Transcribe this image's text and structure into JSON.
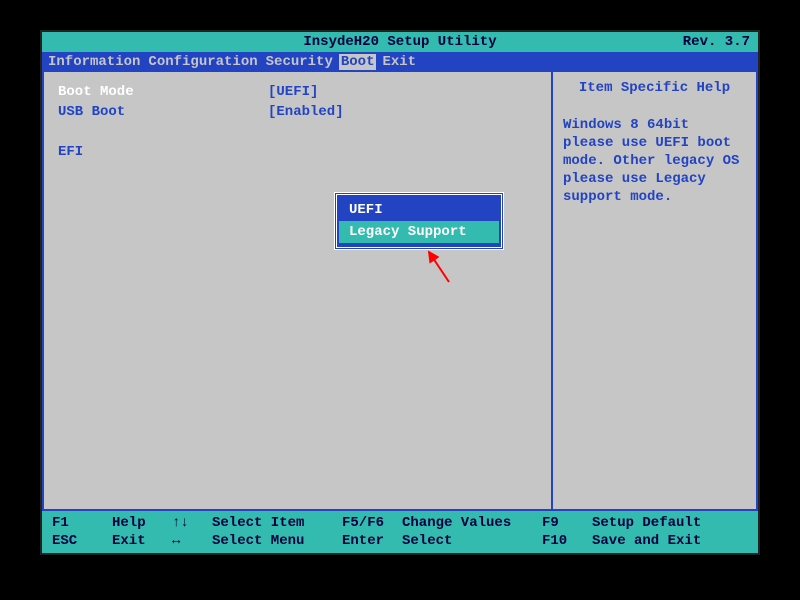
{
  "title": "InsydeH20 Setup Utility",
  "revision": "Rev. 3.7",
  "menu": {
    "items": [
      "Information",
      "Configuration",
      "Security",
      "Boot",
      "Exit"
    ],
    "active_index": 3
  },
  "settings": [
    {
      "label": "Boot Mode",
      "value": "[UEFI]",
      "selected": true
    },
    {
      "label": "USB Boot",
      "value": "[Enabled]",
      "selected": false
    },
    {
      "label": "",
      "value": "",
      "selected": false
    },
    {
      "label": "EFI",
      "value": "",
      "selected": false
    }
  ],
  "popup": {
    "options": [
      "UEFI",
      "Legacy Support"
    ],
    "highlight_index": 1
  },
  "help": {
    "title": "Item Specific Help",
    "text": "Windows 8 64bit please use UEFI boot mode. Other legacy OS please use Legacy support mode."
  },
  "footer": {
    "rows": [
      {
        "k1": "F1",
        "k2": "Help",
        "k3": "↑↓",
        "k4": "Select Item",
        "k5": "F5/F6",
        "k6": "Change Values",
        "k7": "F9",
        "k8": "Setup Default"
      },
      {
        "k1": "ESC",
        "k2": "Exit",
        "k3": "↔",
        "k4": "Select Menu",
        "k5": "Enter",
        "k6": "Select",
        "k7": "F10",
        "k8": "Save and Exit"
      }
    ]
  }
}
